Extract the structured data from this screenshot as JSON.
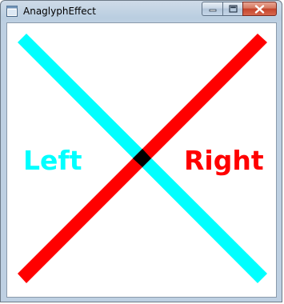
{
  "window": {
    "title": "AnaglyphEffect"
  },
  "icons": {
    "app": "window-app-icon",
    "minimize": "minimize-icon",
    "maximize": "maximize-icon",
    "close": "close-icon"
  },
  "scene": {
    "left_label": "Left",
    "right_label": "Right",
    "left_color": "#00ffff",
    "right_color": "#ff0000",
    "overlap_color": "#000000"
  }
}
